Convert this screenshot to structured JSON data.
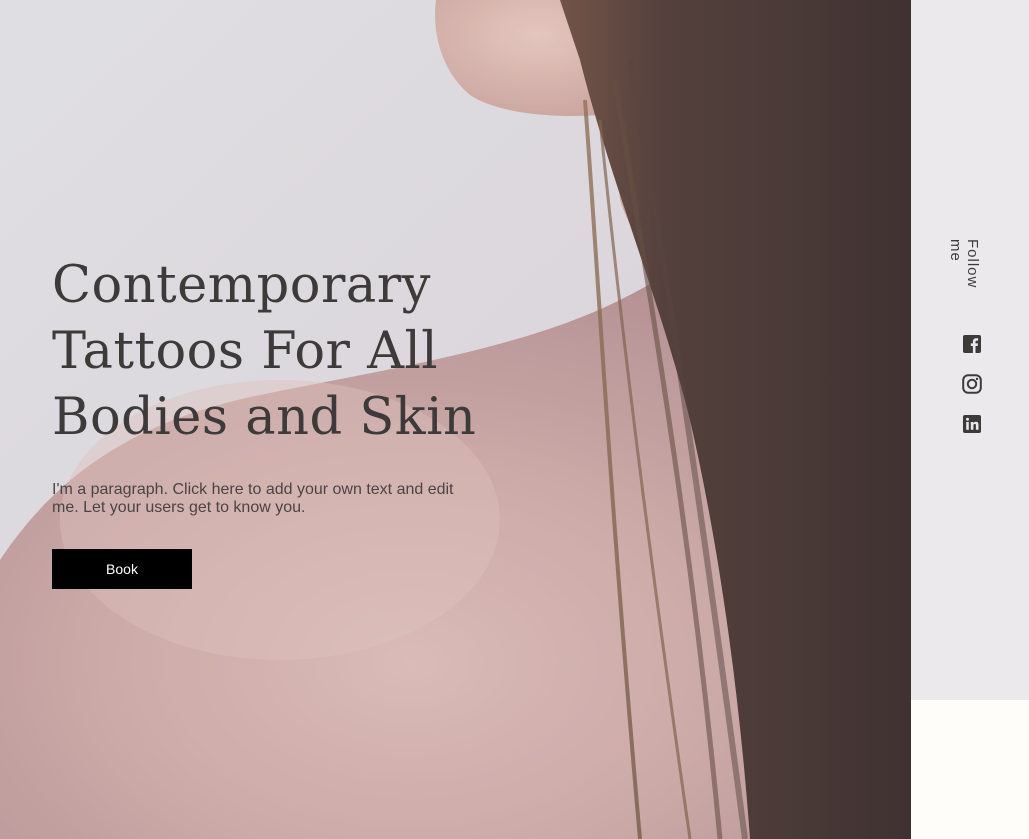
{
  "hero": {
    "headline": "Contemporary Tattoos For All Bodies and Skin",
    "paragraph": "I'm a paragraph. Click here to add your own text and edit me. Let your users get to know you.",
    "book_label": "Book"
  },
  "sidebar": {
    "follow_label": "Follow me",
    "social_icons": [
      "facebook-icon",
      "instagram-icon",
      "linkedin-icon"
    ]
  },
  "colors": {
    "heading": "#3d3a3a",
    "button_bg": "#000000",
    "button_text": "#ffffff",
    "sidebar_bg": "#ebe9ec",
    "page_bg": "#fffdf9"
  }
}
